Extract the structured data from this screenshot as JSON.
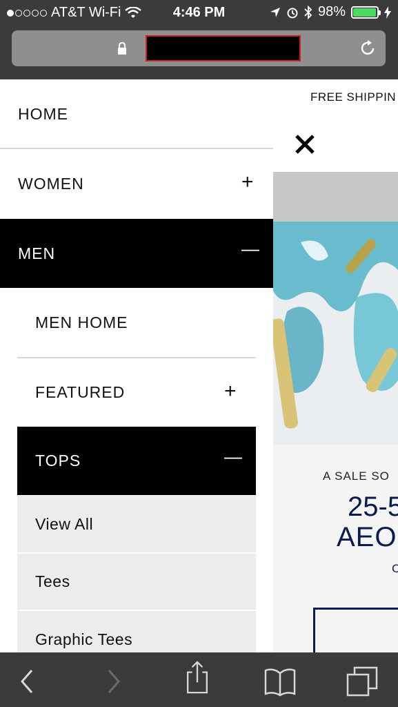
{
  "status_bar": {
    "carrier": "AT&T Wi-Fi",
    "time": "4:46 PM",
    "battery": "98%",
    "battery_level": 0.98
  },
  "browser": {
    "url": "",
    "lock_icon": "lock-icon",
    "reload_icon": "reload-icon"
  },
  "page": {
    "shipping_banner": "FREE SHIPPIN",
    "close_icon": "close-icon",
    "promo_sale": "A SALE SO",
    "promo_big1": "25-5",
    "promo_big2": "AEO",
    "promo_small": "C"
  },
  "menu": {
    "home": "HOME",
    "women": "WOMEN",
    "men": "MEN",
    "men_home": "MEN HOME",
    "featured": "FEATURED",
    "tops": "TOPS",
    "view_all": "View All",
    "tees": "Tees",
    "graphic_tees": "Graphic Tees",
    "plus": "+",
    "minus": "—"
  },
  "toolbar": {
    "icons": [
      "back-icon",
      "forward-icon",
      "share-icon",
      "bookmarks-icon",
      "tabs-icon"
    ]
  }
}
